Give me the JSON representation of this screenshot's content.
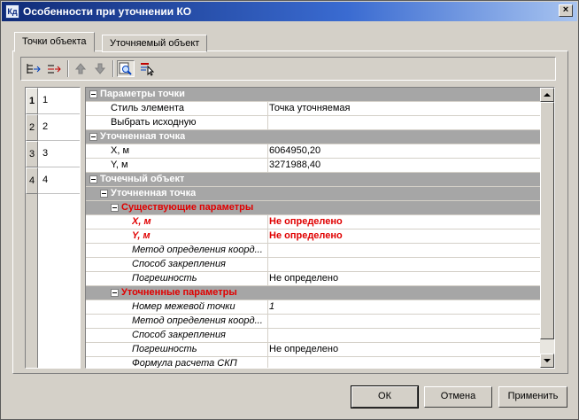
{
  "window": {
    "title": "Особенности при уточнении КО",
    "icon_text": "Кд",
    "close_glyph": "×"
  },
  "tabs": [
    {
      "label": "Точки объекта",
      "active": true
    },
    {
      "label": "Уточняемый объект",
      "active": false
    }
  ],
  "toolbar": {
    "buttons": [
      "add-point-icon",
      "insert-point-icon",
      "move-up-icon",
      "move-down-icon",
      "zoom-to-point-icon",
      "select-points-icon"
    ]
  },
  "points": [
    {
      "index": "1",
      "label": "1",
      "selected": true
    },
    {
      "index": "2",
      "label": "2",
      "selected": false
    },
    {
      "index": "3",
      "label": "3",
      "selected": false
    },
    {
      "index": "4",
      "label": "4",
      "selected": false
    }
  ],
  "properties": {
    "cat_params": "Параметры точки",
    "style_label": "Стиль элемента",
    "style_value": "Точка уточняемая",
    "select_source_label": "Выбрать исходную",
    "cat_refined": "Уточненная точка",
    "x_label": "X, м",
    "x_value": "6064950,20",
    "y_label": "Y, м",
    "y_value": "3271988,40",
    "cat_object": "Точечный объект",
    "sub_refined": "Уточненная точка",
    "sub_existing": "Существующие параметры",
    "ex_x_label": "X, м",
    "ex_x_value": "Не определено",
    "ex_y_label": "Y, м",
    "ex_y_value": "Не определено",
    "ex_method_label": "Метод определения коорд...",
    "ex_fix_label": "Способ закрепления",
    "ex_err_label": "Погрешность",
    "ex_err_value": "Не определено",
    "sub_refined_params": "Уточненные параметры",
    "num_label": "Номер межевой точки",
    "num_value": "1",
    "rf_method_label": "Метод определения коорд...",
    "rf_fix_label": "Способ закрепления",
    "rf_err_label": "Погрешность",
    "rf_err_value": "Не определено",
    "formula_label": "Формула расчета СКП"
  },
  "buttons": {
    "ok": "ОК",
    "cancel": "Отмена",
    "apply": "Применить"
  },
  "colors": {
    "title_start": "#102b77",
    "title_end": "#a8c4f0",
    "category_bg": "#a6a6a6",
    "required_red": "#e00000",
    "dialog_bg": "#d4d0c8"
  }
}
